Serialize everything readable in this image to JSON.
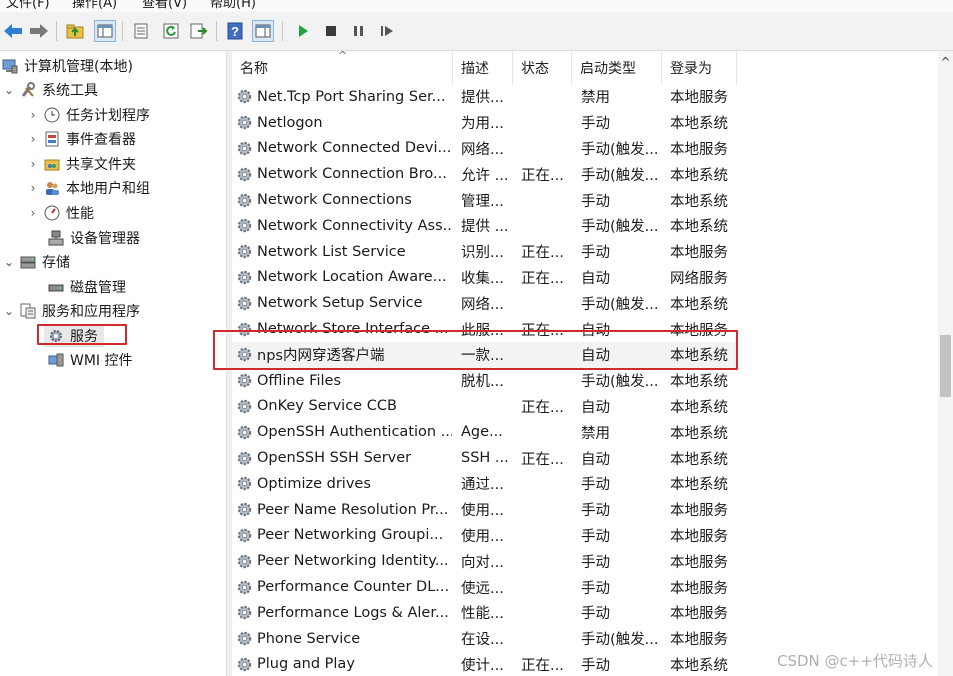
{
  "menu": {
    "file": "文件(F)",
    "action": "操作(A)",
    "view": "查看(V)",
    "help": "帮助(H)"
  },
  "toolbar": {
    "icons": [
      "back-arrow-icon",
      "forward-arrow-icon",
      "up-folder-icon",
      "show-tree-icon",
      "export-list-icon",
      "refresh-icon",
      "export-icon",
      "help-icon",
      "properties-icon",
      "play-icon",
      "stop-icon",
      "pause-icon",
      "resume-icon"
    ]
  },
  "tree": {
    "root": "计算机管理(本地)",
    "system_tools": "系统工具",
    "task_scheduler": "任务计划程序",
    "event_viewer": "事件查看器",
    "shared_folders": "共享文件夹",
    "local_users": "本地用户和组",
    "performance": "性能",
    "device_manager": "设备管理器",
    "storage": "存储",
    "disk_management": "磁盘管理",
    "services_apps": "服务和应用程序",
    "services": "服务",
    "wmi": "WMI 控件"
  },
  "columns": {
    "name": "名称",
    "description": "描述",
    "status": "状态",
    "startup": "启动类型",
    "logon": "登录为"
  },
  "rows": [
    {
      "name": "Net.Tcp Port Sharing Ser...",
      "desc": "提供...",
      "status": "",
      "startup": "禁用",
      "logon": "本地服务"
    },
    {
      "name": "Netlogon",
      "desc": "为用...",
      "status": "",
      "startup": "手动",
      "logon": "本地系统"
    },
    {
      "name": "Network Connected Devi...",
      "desc": "网络...",
      "status": "",
      "startup": "手动(触发...",
      "logon": "本地服务"
    },
    {
      "name": "Network Connection Bro...",
      "desc": "允许 ...",
      "status": "正在...",
      "startup": "手动(触发...",
      "logon": "本地系统"
    },
    {
      "name": "Network Connections",
      "desc": "管理...",
      "status": "",
      "startup": "手动",
      "logon": "本地系统"
    },
    {
      "name": "Network Connectivity Ass...",
      "desc": "提供 ...",
      "status": "",
      "startup": "手动(触发...",
      "logon": "本地系统"
    },
    {
      "name": "Network List Service",
      "desc": "识别...",
      "status": "正在...",
      "startup": "手动",
      "logon": "本地服务"
    },
    {
      "name": "Network Location Aware...",
      "desc": "收集...",
      "status": "正在...",
      "startup": "自动",
      "logon": "网络服务"
    },
    {
      "name": "Network Setup Service",
      "desc": "网络...",
      "status": "",
      "startup": "手动(触发...",
      "logon": "本地系统"
    },
    {
      "name": "Network Store Interface ...",
      "desc": "此服...",
      "status": "正在...",
      "startup": "自动",
      "logon": "本地服务"
    },
    {
      "name": "nps内网穿透客户端",
      "desc": "一款...",
      "status": "",
      "startup": "自动",
      "logon": "本地系统"
    },
    {
      "name": "Offline Files",
      "desc": "脱机...",
      "status": "",
      "startup": "手动(触发...",
      "logon": "本地系统"
    },
    {
      "name": "OnKey Service CCB",
      "desc": "",
      "status": "正在...",
      "startup": "自动",
      "logon": "本地系统"
    },
    {
      "name": "OpenSSH Authentication ...",
      "desc": "Age...",
      "status": "",
      "startup": "禁用",
      "logon": "本地系统"
    },
    {
      "name": "OpenSSH SSH Server",
      "desc": "SSH ...",
      "status": "正在...",
      "startup": "自动",
      "logon": "本地系统"
    },
    {
      "name": "Optimize drives",
      "desc": "通过...",
      "status": "",
      "startup": "手动",
      "logon": "本地系统"
    },
    {
      "name": "Peer Name Resolution Pr...",
      "desc": "使用...",
      "status": "",
      "startup": "手动",
      "logon": "本地服务"
    },
    {
      "name": "Peer Networking Groupi...",
      "desc": "使用...",
      "status": "",
      "startup": "手动",
      "logon": "本地服务"
    },
    {
      "name": "Peer Networking Identity...",
      "desc": "向对...",
      "status": "",
      "startup": "手动",
      "logon": "本地服务"
    },
    {
      "name": "Performance Counter DL...",
      "desc": "使远...",
      "status": "",
      "startup": "手动",
      "logon": "本地服务"
    },
    {
      "name": "Performance Logs & Aler...",
      "desc": "性能...",
      "status": "",
      "startup": "手动",
      "logon": "本地服务"
    },
    {
      "name": "Phone Service",
      "desc": "在设...",
      "status": "",
      "startup": "手动(触发...",
      "logon": "本地服务"
    },
    {
      "name": "Plug and Play",
      "desc": "使计...",
      "status": "正在...",
      "startup": "手动",
      "logon": "本地系统"
    }
  ],
  "watermark": "CSDN @c++代码诗人"
}
